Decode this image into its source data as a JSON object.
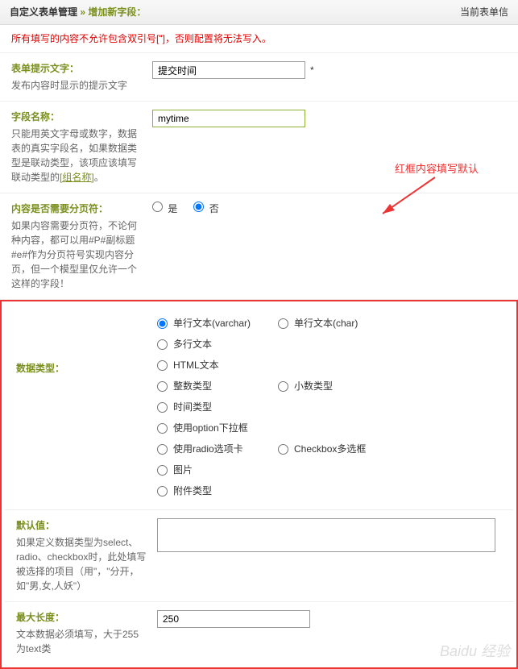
{
  "header": {
    "title_prefix": "自定义表单管理",
    "arrow": "»",
    "title_suffix": "增加新字段：",
    "right": "当前表单信"
  },
  "warning": "所有填写的内容不允许包含双引号[\"]，否则配置将无法写入。",
  "fields": {
    "f1": {
      "title": "表单提示文字：",
      "desc": "发布内容时显示的提示文字",
      "value": "提交时间",
      "star": "*"
    },
    "f2": {
      "title": "字段名称：",
      "desc1": "只能用英文字母或数字，数据表的真实字段名，如果数据类型是联动类型，该项应该填写联动类型的",
      "link": "[组名称]",
      "desc2": "。",
      "value": "mytime"
    },
    "f3": {
      "title": "内容是否需要分页符：",
      "desc": "如果内容需要分页符，不论何种内容，都可以用#P#副标题#e#作为分页符号实现内容分页，但一个模型里仅允许一个这样的字段！",
      "yes": "是",
      "no": "否"
    },
    "f4": {
      "title": "数据类型：",
      "opts": {
        "o1": "单行文本(varchar)",
        "o2": "单行文本(char)",
        "o3": "多行文本",
        "o4": "HTML文本",
        "o5": "整数类型",
        "o6": "小数类型",
        "o7": "时间类型",
        "o8": "使用option下拉框",
        "o9": "使用radio选项卡",
        "o10": "Checkbox多选框",
        "o11": "图片",
        "o12": "附件类型"
      }
    },
    "f5": {
      "title": "默认值：",
      "desc": "如果定义数据类型为select、radio、checkbox时，此处填写被选择的项目（用\"，\"分开，如\"男,女,人妖\"）"
    },
    "f6": {
      "title": "最大长度：",
      "desc": "文本数据必须填写，大于255为text类",
      "value": "250"
    }
  },
  "annotation": "红框内容填写默认",
  "watermark": "Baidu 经验"
}
